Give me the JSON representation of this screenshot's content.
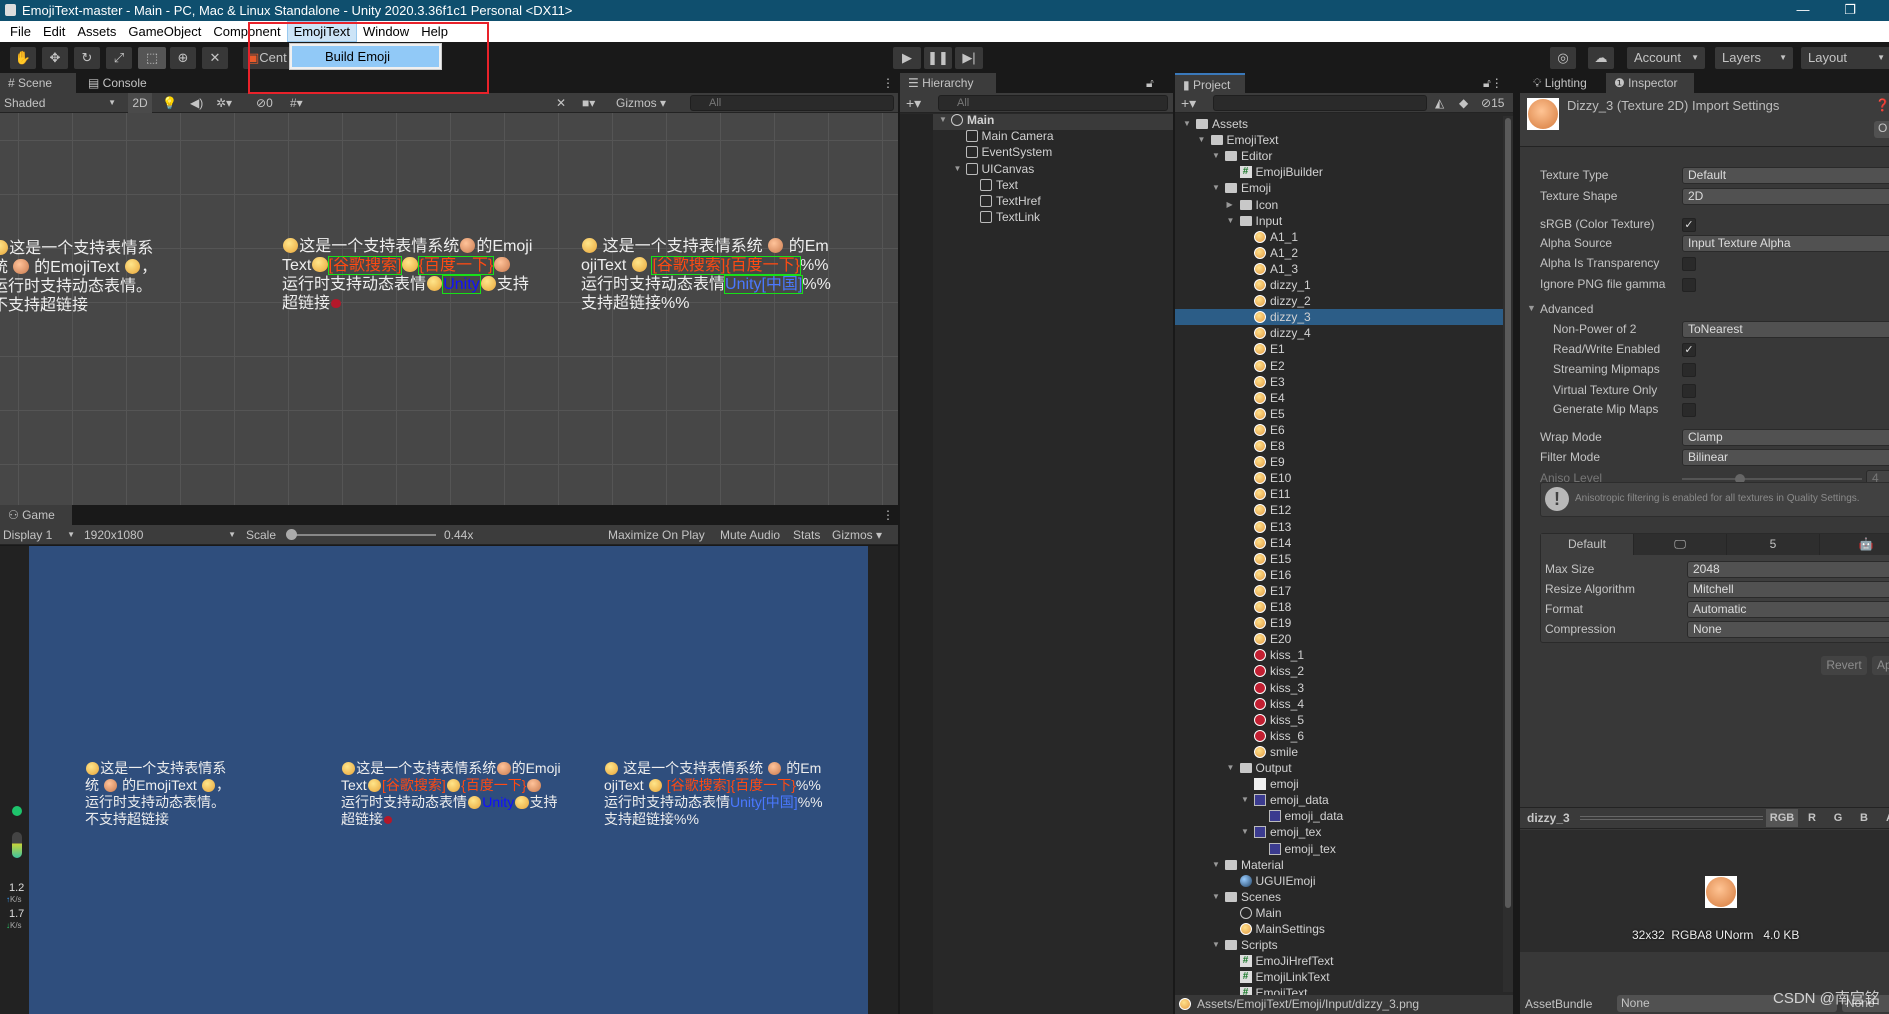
{
  "window": {
    "title": "EmojiText-master - Main - PC, Mac & Linux Standalone - Unity 2020.3.36f1c1 Personal <DX11>",
    "minimize": "—",
    "maximize": "❐"
  },
  "menu": {
    "items": [
      "File",
      "Edit",
      "Assets",
      "GameObject",
      "Component",
      "EmojiText",
      "Window",
      "Help"
    ],
    "open_menu": "EmojiText",
    "dropdown_item": "Build Emoji",
    "highlight_color": "#e8222a"
  },
  "toolbar": {
    "center_label": "Cent",
    "account": "Account",
    "layers": "Layers",
    "layout": "Layout",
    "play": "▶",
    "pause": "❚❚",
    "step": "▶|"
  },
  "scene": {
    "tab": "Scene",
    "console_tab": "Console",
    "shading": "Shaded",
    "mode_2d": "2D",
    "hidden_count": "0",
    "gizmos": "Gizmos",
    "search_placeholder": "All"
  },
  "game": {
    "tab": "Game",
    "display": "Display 1",
    "resolution": "1920x1080",
    "scale_label": "Scale",
    "scale_value": "0.44x",
    "scale_fraction": 0.0,
    "maximize": "Maximize On Play",
    "mute": "Mute Audio",
    "stats": "Stats",
    "gizmos": "Gizmos",
    "net_up": "1.2",
    "net_up_unit": "K/s",
    "net_down": "1.7",
    "net_down_unit": "K/s"
  },
  "texts": [
    {
      "lines": [
        [
          {
            "e": "emo"
          },
          {
            "t": "这是一个支持表情系"
          }
        ],
        [
          {
            "t": "统 "
          },
          {
            "e": "face"
          },
          {
            "t": " 的EmojiText "
          },
          {
            "e": "emo"
          },
          {
            "t": "，"
          }
        ],
        [
          {
            "t": "运行时支持动态表情。"
          }
        ],
        [
          {
            "t": "不支持超链接"
          }
        ]
      ]
    },
    {
      "lines": [
        [
          {
            "e": "emo"
          },
          {
            "t": "这是一个支持表情系统"
          },
          {
            "e": "face"
          },
          {
            "t": "的Emoji"
          }
        ],
        [
          {
            "t": "Text"
          },
          {
            "e": "emo"
          },
          {
            "t": "[谷歌搜索]",
            "c": "#ff4a12",
            "box": 1
          },
          {
            "e": "emo"
          },
          {
            "t": "{百度一下}",
            "c": "#ff4a12",
            "box": 1
          },
          {
            "e": "face"
          }
        ],
        [
          {
            "t": "运行时支持动态表情"
          },
          {
            "e": "emo"
          },
          {
            "t": "Unity",
            "c": "#1010ff",
            "box": 1
          },
          {
            "e": "emo"
          },
          {
            "t": "支持"
          }
        ],
        [
          {
            "t": "超链接"
          },
          {
            "e": "lips"
          }
        ]
      ]
    },
    {
      "lines": [
        [
          {
            "e": "emo"
          },
          {
            "t": " 这是一个支持表情系统 "
          },
          {
            "e": "face"
          },
          {
            "t": " 的Em"
          }
        ],
        [
          {
            "t": "ojiText "
          },
          {
            "e": "emo"
          },
          {
            "t": " "
          },
          {
            "t": "[谷歌搜索]{百度一下}",
            "c": "#ff4a12",
            "box": 1
          },
          {
            "t": "%%"
          }
        ],
        [
          {
            "t": "运行时支持动态表情"
          },
          {
            "t": "Unity[中国]",
            "c": "#4a78ff",
            "box": 1
          },
          {
            "t": "%%"
          }
        ],
        [
          {
            "t": "支持超链接%%"
          }
        ]
      ]
    }
  ],
  "hierarchy": {
    "tab": "Hierarchy",
    "search_placeholder": "All",
    "items": [
      {
        "label": "Main",
        "depth": 0,
        "icon": "scene",
        "open": true
      },
      {
        "label": "Main Camera",
        "depth": 1,
        "icon": "go"
      },
      {
        "label": "EventSystem",
        "depth": 1,
        "icon": "go"
      },
      {
        "label": "UICanvas",
        "depth": 1,
        "icon": "go",
        "open": true
      },
      {
        "label": "Text",
        "depth": 2,
        "icon": "go"
      },
      {
        "label": "TextHref",
        "depth": 2,
        "icon": "go"
      },
      {
        "label": "TextLink",
        "depth": 2,
        "icon": "go"
      }
    ]
  },
  "project": {
    "tab": "Project",
    "hidden_count": "15",
    "status_path": "Assets/EmojiText/Emoji/Input/dizzy_3.png",
    "selected": "dizzy_3",
    "items": [
      {
        "label": "Assets",
        "depth": 0,
        "icon": "folder",
        "open": true
      },
      {
        "label": "EmojiText",
        "depth": 1,
        "icon": "folder",
        "open": true
      },
      {
        "label": "Editor",
        "depth": 2,
        "icon": "folder",
        "open": true
      },
      {
        "label": "EmojiBuilder",
        "depth": 3,
        "icon": "script"
      },
      {
        "label": "Emoji",
        "depth": 2,
        "icon": "folder",
        "open": true
      },
      {
        "label": "Icon",
        "depth": 3,
        "icon": "folder",
        "open": false
      },
      {
        "label": "Input",
        "depth": 3,
        "icon": "folder",
        "open": true
      },
      {
        "label": "A1_1",
        "depth": 4,
        "icon": "emoji"
      },
      {
        "label": "A1_2",
        "depth": 4,
        "icon": "emoji"
      },
      {
        "label": "A1_3",
        "depth": 4,
        "icon": "emoji"
      },
      {
        "label": "dizzy_1",
        "depth": 4,
        "icon": "emoji"
      },
      {
        "label": "dizzy_2",
        "depth": 4,
        "icon": "emoji"
      },
      {
        "label": "dizzy_3",
        "depth": 4,
        "icon": "emoji",
        "selected": true
      },
      {
        "label": "dizzy_4",
        "depth": 4,
        "icon": "emoji"
      },
      {
        "label": "E1",
        "depth": 4,
        "icon": "emoji"
      },
      {
        "label": "E2",
        "depth": 4,
        "icon": "emoji"
      },
      {
        "label": "E3",
        "depth": 4,
        "icon": "emoji"
      },
      {
        "label": "E4",
        "depth": 4,
        "icon": "emoji"
      },
      {
        "label": "E5",
        "depth": 4,
        "icon": "emoji"
      },
      {
        "label": "E6",
        "depth": 4,
        "icon": "emoji"
      },
      {
        "label": "E8",
        "depth": 4,
        "icon": "emoji"
      },
      {
        "label": "E9",
        "depth": 4,
        "icon": "emoji"
      },
      {
        "label": "E10",
        "depth": 4,
        "icon": "emoji"
      },
      {
        "label": "E11",
        "depth": 4,
        "icon": "emoji"
      },
      {
        "label": "E12",
        "depth": 4,
        "icon": "emoji"
      },
      {
        "label": "E13",
        "depth": 4,
        "icon": "emoji"
      },
      {
        "label": "E14",
        "depth": 4,
        "icon": "emoji"
      },
      {
        "label": "E15",
        "depth": 4,
        "icon": "emoji"
      },
      {
        "label": "E16",
        "depth": 4,
        "icon": "emoji"
      },
      {
        "label": "E17",
        "depth": 4,
        "icon": "emoji"
      },
      {
        "label": "E18",
        "depth": 4,
        "icon": "emoji"
      },
      {
        "label": "E19",
        "depth": 4,
        "icon": "emoji"
      },
      {
        "label": "E20",
        "depth": 4,
        "icon": "emoji"
      },
      {
        "label": "kiss_1",
        "depth": 4,
        "icon": "kiss"
      },
      {
        "label": "kiss_2",
        "depth": 4,
        "icon": "kiss"
      },
      {
        "label": "kiss_3",
        "depth": 4,
        "icon": "kiss"
      },
      {
        "label": "kiss_4",
        "depth": 4,
        "icon": "kiss"
      },
      {
        "label": "kiss_5",
        "depth": 4,
        "icon": "kiss"
      },
      {
        "label": "kiss_6",
        "depth": 4,
        "icon": "kiss"
      },
      {
        "label": "smile",
        "depth": 4,
        "icon": "emoji"
      },
      {
        "label": "Output",
        "depth": 3,
        "icon": "folder",
        "open": true
      },
      {
        "label": "emoji",
        "depth": 4,
        "icon": "file"
      },
      {
        "label": "emoji_data",
        "depth": 4,
        "icon": "asset",
        "open": true
      },
      {
        "label": "emoji_data",
        "depth": 5,
        "icon": "asset"
      },
      {
        "label": "emoji_tex",
        "depth": 4,
        "icon": "asset",
        "open": true
      },
      {
        "label": "emoji_tex",
        "depth": 5,
        "icon": "asset"
      },
      {
        "label": "Material",
        "depth": 2,
        "icon": "folder",
        "open": true
      },
      {
        "label": "UGUIEmoji",
        "depth": 3,
        "icon": "mat"
      },
      {
        "label": "Scenes",
        "depth": 2,
        "icon": "folder",
        "open": true
      },
      {
        "label": "Main",
        "depth": 3,
        "icon": "scene"
      },
      {
        "label": "MainSettings",
        "depth": 3,
        "icon": "emoji"
      },
      {
        "label": "Scripts",
        "depth": 2,
        "icon": "folder",
        "open": true
      },
      {
        "label": "EmoJiHrefText",
        "depth": 3,
        "icon": "script"
      },
      {
        "label": "EmojiLinkText",
        "depth": 3,
        "icon": "script"
      },
      {
        "label": "EmojiText",
        "depth": 3,
        "icon": "script"
      }
    ]
  },
  "inspector": {
    "lighting_tab": "Lighting",
    "inspector_tab": "Inspector",
    "title": "Dizzy_3 (Texture 2D) Import Settings",
    "open_button": "O",
    "fields": [
      {
        "label": "Texture Type",
        "value": "Default",
        "type": "select"
      },
      {
        "label": "Texture Shape",
        "value": "2D",
        "type": "select"
      },
      {
        "label": "sRGB (Color Texture)",
        "checked": true,
        "type": "check"
      },
      {
        "label": "Alpha Source",
        "value": "Input Texture Alpha",
        "type": "select"
      },
      {
        "label": "Alpha Is Transparency",
        "checked": false,
        "type": "check"
      },
      {
        "label": "Ignore PNG file gamma",
        "checked": false,
        "type": "check"
      },
      {
        "label": "Advanced",
        "type": "foldout"
      },
      {
        "label": "Non-Power of 2",
        "value": "ToNearest",
        "type": "select",
        "indent": true
      },
      {
        "label": "Read/Write Enabled",
        "checked": true,
        "type": "check",
        "indent": true
      },
      {
        "label": "Streaming Mipmaps",
        "checked": false,
        "type": "check",
        "indent": true
      },
      {
        "label": "Virtual Texture Only",
        "checked": false,
        "type": "check",
        "indent": true
      },
      {
        "label": "Generate Mip Maps",
        "checked": false,
        "type": "check",
        "indent": true
      },
      {
        "label": "Wrap Mode",
        "value": "Clamp",
        "type": "select"
      },
      {
        "label": "Filter Mode",
        "value": "Bilinear",
        "type": "select"
      },
      {
        "label": "Aniso Level",
        "value": "4",
        "type": "slider",
        "disabled": true,
        "level": 4,
        "max": 16
      }
    ],
    "help_text": "Anisotropic filtering is enabled for all textures in Quality Settings.",
    "platform_tabs": [
      "Default",
      "standalone-monitor-icon",
      "webgl-html5-icon",
      "android-icon"
    ],
    "platform_fields": [
      {
        "label": "Max Size",
        "value": "2048"
      },
      {
        "label": "Resize Algorithm",
        "value": "Mitchell"
      },
      {
        "label": "Format",
        "value": "Automatic"
      },
      {
        "label": "Compression",
        "value": "None"
      }
    ],
    "revert": "Revert",
    "apply": "Ap",
    "preview": {
      "name": "dizzy_3",
      "channels": [
        "RGB",
        "R",
        "G",
        "B",
        "A"
      ],
      "info": "32x32  RGBA8 UNorm   4.0 KB"
    },
    "asset_bundle_label": "AssetBundle",
    "asset_bundle_value": "None",
    "asset_bundle_variant": "None"
  },
  "watermark": "CSDN @南宫铭"
}
